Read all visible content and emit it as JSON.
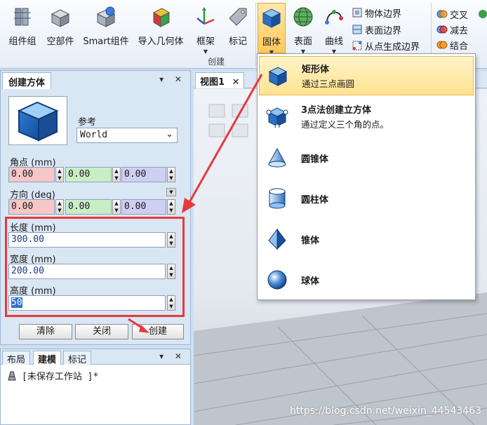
{
  "ribbon": {
    "buttons": [
      {
        "label": "组件组",
        "icon": "component-group-icon"
      },
      {
        "label": "空部件",
        "icon": "empty-part-icon"
      },
      {
        "label": "Smart组件",
        "icon": "smart-component-icon"
      },
      {
        "label": "导入几何体",
        "icon": "import-geometry-icon"
      },
      {
        "label": "框架",
        "icon": "frame-icon"
      },
      {
        "label": "标记",
        "icon": "tag-icon"
      },
      {
        "label": "固体",
        "icon": "solid-icon"
      },
      {
        "label": "表面",
        "icon": "surface-icon"
      },
      {
        "label": "曲线",
        "icon": "curve-icon"
      }
    ],
    "small": [
      "物体边界",
      "表面边界",
      "从点生成边界",
      "交叉",
      "减去",
      "结合"
    ],
    "group_label": "创建"
  },
  "menu": {
    "items": [
      {
        "title": "矩形体",
        "sub": "通过三点画圆"
      },
      {
        "title": "3点法创建立方体",
        "sub": "通过定义三个角的点。"
      },
      {
        "title": "圆锥体",
        "sub": ""
      },
      {
        "title": "圆柱体",
        "sub": ""
      },
      {
        "title": "锥体",
        "sub": ""
      },
      {
        "title": "球体",
        "sub": ""
      }
    ]
  },
  "panel": {
    "tab_title": "创建方体",
    "ctrls": "▾ ✕",
    "ref_label": "参考",
    "ref_value": "World",
    "corner_label": "角点 (mm)",
    "corner": [
      "0.00",
      "0.00",
      "0.00"
    ],
    "dir_label": "方向 (deg)",
    "dir": [
      "0.00",
      "0.00",
      "0.00"
    ],
    "length_label": "长度 (mm)",
    "length": "300.00",
    "width_label": "宽度 (mm)",
    "width": "200.00",
    "height_label": "高度 (mm)",
    "height": "50",
    "btn_clear": "清除",
    "btn_close": "关闭",
    "btn_create": "创建"
  },
  "panel2": {
    "tabs": [
      "布局",
      "建模",
      "标记"
    ],
    "ctrls": "▾ ✕",
    "station": "[未保存工作站 ]*"
  },
  "view": {
    "tab": "视图1",
    "close": "✕"
  },
  "watermark": "https://blog.csdn.net/weixin_44543463"
}
